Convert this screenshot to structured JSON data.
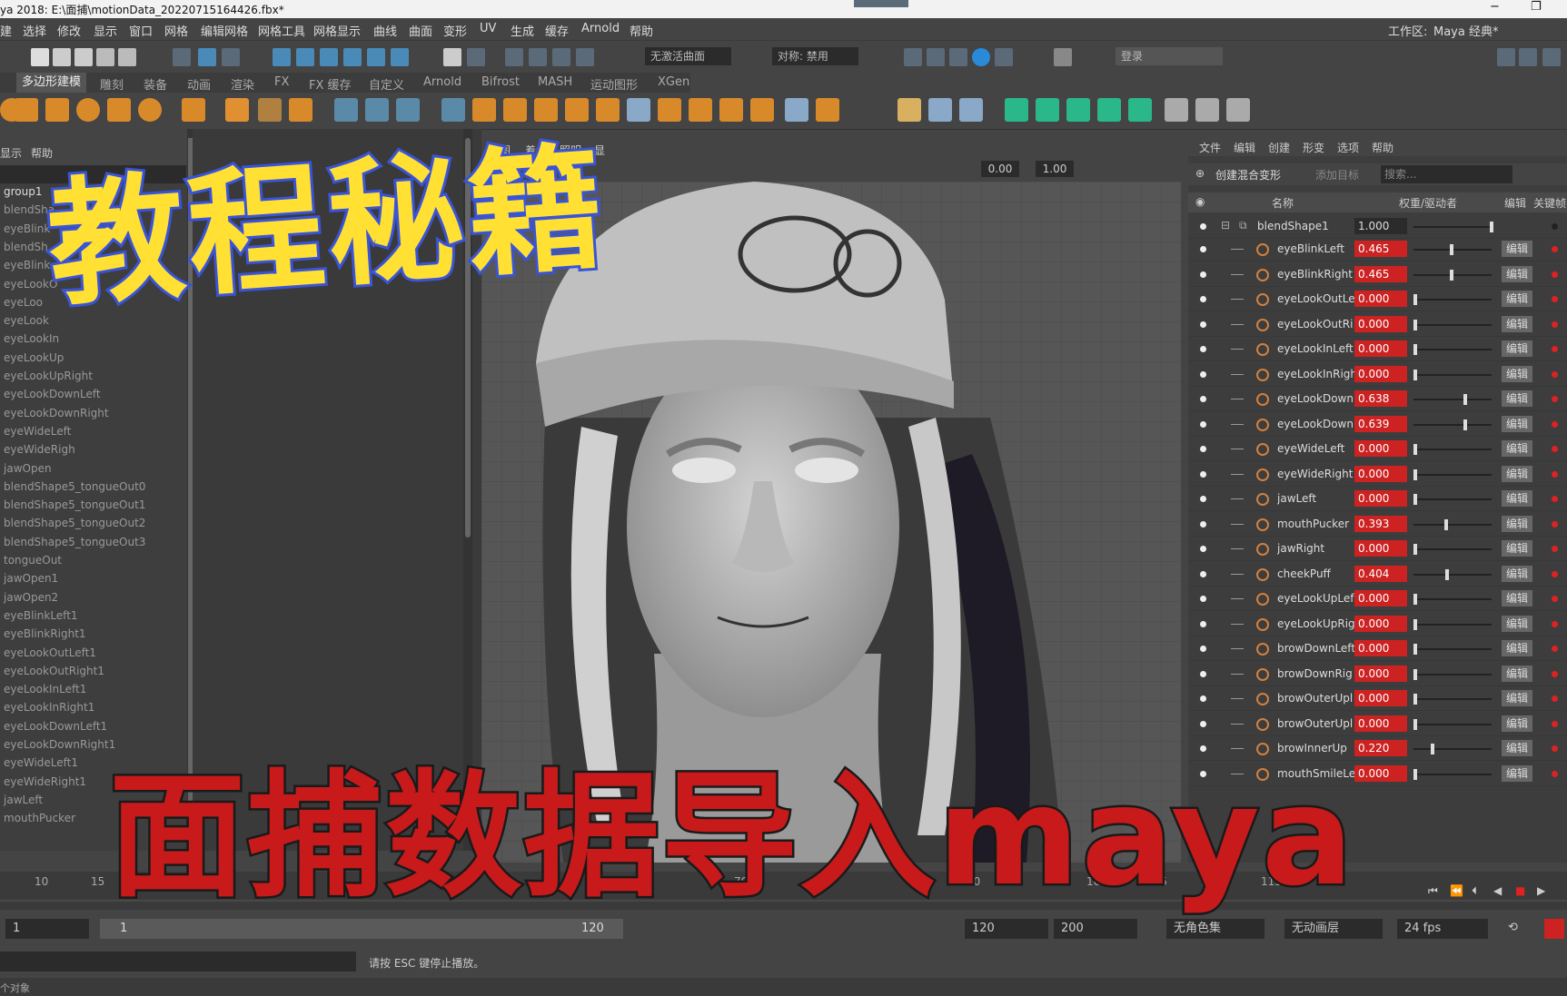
{
  "window": {
    "title": "ya 2018: E:\\面捕\\motionData_20220715164426.fbx*",
    "min": "−",
    "max": "❐"
  },
  "menubar": {
    "items": [
      "建",
      "选择",
      "修改",
      "显示",
      "窗口",
      "网格",
      "编辑网格",
      "网格工具",
      "网格显示",
      "曲线",
      "曲面",
      "变形",
      "UV",
      "生成",
      "缓存",
      "Arnold",
      "帮助"
    ],
    "workspace_label": "工作区:",
    "workspace_value": "Maya 经典*"
  },
  "statusline": {
    "live_surface": "无激活曲面",
    "symmetry": "对称: 禁用",
    "login": "登录"
  },
  "shelf_tabs": [
    "多边形建模",
    "雕刻",
    "装备",
    "动画",
    "渲染",
    "FX",
    "FX 缓存",
    "自定义",
    "Arnold",
    "Bifrost",
    "MASH",
    "运动图形",
    "XGen"
  ],
  "outliner": {
    "menu": [
      "显示",
      "帮助"
    ],
    "items": [
      "group1",
      "blendSha",
      "eyeBlink",
      "blendSh",
      "eyeBlink",
      "eyeLookO",
      "eyeLoo",
      "eyeLook",
      "eyeLookIn",
      "eyeLookUp",
      "eyeLookUpRight",
      "eyeLookDownLeft",
      "eyeLookDownRight",
      "eyeWideLeft",
      "eyeWideRigh",
      "jawOpen",
      "blendShape5_tongueOut0",
      "blendShape5_tongueOut1",
      "blendShape5_tongueOut2",
      "blendShape5_tongueOut3",
      "tongueOut",
      "jawOpen1",
      "jawOpen2",
      "eyeBlinkLeft1",
      "eyeBlinkRight1",
      "eyeLookOutLeft1",
      "eyeLookOutRight1",
      "eyeLookInLeft1",
      "eyeLookInRight1",
      "eyeLookDownLeft1",
      "eyeLookDownRight1",
      "eyeWideLeft1",
      "eyeWideRight1",
      "jawLeft",
      "mouthPucker"
    ]
  },
  "viewport": {
    "menu": [
      "视图",
      "着色",
      "照明",
      "显"
    ],
    "field1": "0.00",
    "field2": "1.00"
  },
  "shape_editor": {
    "menu": [
      "文件",
      "编辑",
      "创建",
      "形变",
      "选项",
      "帮助"
    ],
    "create_btn": "创建混合变形",
    "add_target": "添加目标",
    "search_placeholder": "搜索...",
    "col_name": "名称",
    "col_weight": "权重/驱动者",
    "col_edit": "编辑",
    "col_key": "关键帧",
    "group": {
      "name": "blendShape1",
      "value": "1.000"
    },
    "edit_label": "编辑",
    "rows": [
      {
        "name": "eyeBlinkLeft",
        "value": "0.465",
        "weight": 0.465
      },
      {
        "name": "eyeBlinkRight",
        "value": "0.465",
        "weight": 0.465
      },
      {
        "name": "eyeLookOutLe",
        "value": "0.000",
        "weight": 0
      },
      {
        "name": "eyeLookOutRi",
        "value": "0.000",
        "weight": 0
      },
      {
        "name": "eyeLookInLeft",
        "value": "0.000",
        "weight": 0
      },
      {
        "name": "eyeLookInRigh",
        "value": "0.000",
        "weight": 0
      },
      {
        "name": "eyeLookDown",
        "value": "0.638",
        "weight": 0.638
      },
      {
        "name": "eyeLookDown",
        "value": "0.639",
        "weight": 0.639
      },
      {
        "name": "eyeWideLeft",
        "value": "0.000",
        "weight": 0
      },
      {
        "name": "eyeWideRight",
        "value": "0.000",
        "weight": 0
      },
      {
        "name": "jawLeft",
        "value": "0.000",
        "weight": 0
      },
      {
        "name": "mouthPucker",
        "value": "0.393",
        "weight": 0.393
      },
      {
        "name": "jawRight",
        "value": "0.000",
        "weight": 0
      },
      {
        "name": "cheekPuff",
        "value": "0.404",
        "weight": 0.404
      },
      {
        "name": "eyeLookUpLef",
        "value": "0.000",
        "weight": 0
      },
      {
        "name": "eyeLookUpRig",
        "value": "0.000",
        "weight": 0
      },
      {
        "name": "browDownLeft",
        "value": "0.000",
        "weight": 0
      },
      {
        "name": "browDownRig",
        "value": "0.000",
        "weight": 0
      },
      {
        "name": "browOuterUpl",
        "value": "0.000",
        "weight": 0
      },
      {
        "name": "browOuterUpl",
        "value": "0.000",
        "weight": 0
      },
      {
        "name": "browInnerUp",
        "value": "0.220",
        "weight": 0.22
      },
      {
        "name": "mouthSmileLe",
        "value": "0.000",
        "weight": 0
      }
    ]
  },
  "timeline": {
    "ticks": [
      "10",
      "15",
      "70",
      "90",
      "100",
      "105",
      "110",
      "115"
    ]
  },
  "range": {
    "start": "1",
    "slider_start": "1",
    "slider_end": "120",
    "end": "120",
    "max": "200",
    "char_set": "无角色集",
    "anim_layer": "无动画层",
    "fps": "24 fps"
  },
  "helpline": {
    "text": "请按 ESC 键停止播放。"
  },
  "bottom": {
    "text": "个对象"
  },
  "overlay": {
    "top": "教程秘籍",
    "bottom": "面捕数据导入maya"
  },
  "colors": {
    "value_red": "#cc2222",
    "overlay_yellow": "#ffe033",
    "overlay_blue": "#3a54d8",
    "overlay_red": "#c81a1a"
  }
}
